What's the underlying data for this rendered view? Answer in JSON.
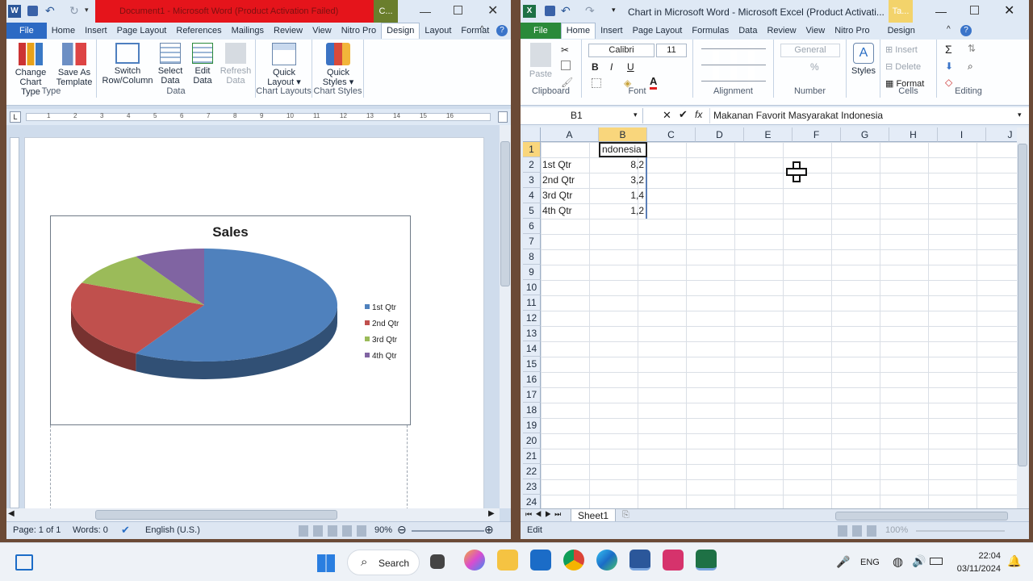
{
  "word": {
    "title": "Document1 - Microsoft Word (Product Activation Failed)",
    "context_tab": "C...",
    "tabs": [
      "File",
      "Home",
      "Insert",
      "Page Layout",
      "References",
      "Mailings",
      "Review",
      "View",
      "Nitro Pro",
      "Design",
      "Layout",
      "Format"
    ],
    "ribbon": {
      "change_chart_type": "Change Chart Type",
      "save_as_template": "Save As Template",
      "type_group": "Type",
      "switch_row_col": "Switch Row/Column",
      "select_data": "Select Data",
      "edit_data": "Edit Data",
      "refresh_data": "Refresh Data",
      "data_group": "Data",
      "quick_layout": "Quick Layout",
      "chart_layouts_group": "Chart Layouts",
      "quick_styles": "Quick Styles",
      "chart_styles_group": "Chart Styles"
    },
    "ruler_marks": [
      "1",
      "2",
      "3",
      "4",
      "5",
      "6",
      "7",
      "8",
      "9",
      "10",
      "11",
      "12",
      "13",
      "14",
      "15",
      "16"
    ],
    "status": {
      "page": "Page: 1 of 1",
      "words": "Words: 0",
      "language": "English (U.S.)",
      "zoom": "90%"
    }
  },
  "chart_data": {
    "type": "pie",
    "title": "Sales",
    "categories": [
      "1st Qtr",
      "2nd Qtr",
      "3rd Qtr",
      "4th Qtr"
    ],
    "values": [
      8.2,
      3.2,
      1.4,
      1.2
    ],
    "colors": [
      "#4f81bd",
      "#c0504d",
      "#9bbb59",
      "#8064a2"
    ],
    "legend_position": "right"
  },
  "excel": {
    "title": "Chart in Microsoft Word - Microsoft Excel (Product Activati...",
    "context_tab": "Ta...",
    "tabs": [
      "File",
      "Home",
      "Insert",
      "Page Layout",
      "Formulas",
      "Data",
      "Review",
      "View",
      "Nitro Pro",
      "Design"
    ],
    "ribbon": {
      "paste": "Paste",
      "clipboard": "Clipboard",
      "font_name": "Calibri",
      "font_size": "11",
      "font_group": "Font",
      "alignment": "Alignment",
      "number_format": "General",
      "number_group": "Number",
      "styles": "Styles",
      "insert": "Insert",
      "delete": "Delete",
      "format": "Format",
      "cells_group": "Cells",
      "editing_group": "Editing"
    },
    "name_box": "B1",
    "formula": "Makanan Favorit Masyarakat Indonesia",
    "columns": [
      "A",
      "B",
      "C",
      "D",
      "E",
      "F",
      "G",
      "H",
      "I",
      "J"
    ],
    "rows": [
      "1",
      "2",
      "3",
      "4",
      "5",
      "6",
      "7",
      "8",
      "9",
      "10",
      "11",
      "12",
      "13",
      "14",
      "15",
      "16",
      "17",
      "18",
      "19",
      "20",
      "21",
      "22",
      "23",
      "24"
    ],
    "b1_display": "ndonesia",
    "data_rows": [
      {
        "label": "1st Qtr",
        "value": "8,2"
      },
      {
        "label": "2nd Qtr",
        "value": "3,2"
      },
      {
        "label": "3rd Qtr",
        "value": "1,4"
      },
      {
        "label": "4th Qtr",
        "value": "1,2"
      }
    ],
    "sheet_tab": "Sheet1",
    "status_mode": "Edit",
    "zoom": "100%"
  },
  "taskbar": {
    "search": "Search",
    "lang": "ENG",
    "time": "22:04",
    "date": "03/11/2024"
  }
}
